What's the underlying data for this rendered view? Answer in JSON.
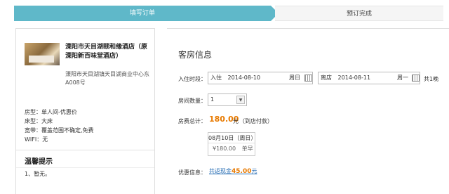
{
  "progress": {
    "step1": "填写订单",
    "step2": "预订完成"
  },
  "hotel": {
    "name": "溧阳市天目湖颐和缘酒店（原溧阳新百味堂酒店）",
    "address": "溧阳市天目湖镇天目湖商业中心东A008号",
    "room_type_label": "房型：",
    "room_type": "单人间-优惠价",
    "bed_label": "床型：",
    "bed": "大床",
    "broadband_label": "宽带：",
    "broadband": "覆盖范围不确定,免费",
    "wifi_label": "WIFI：",
    "wifi": "无"
  },
  "tips": {
    "title": "温馨提示",
    "item1": "1、暂无。"
  },
  "form": {
    "section_title": "客房信息",
    "stay_label": "入住时段：",
    "checkin_prefix": "入住",
    "checkin_date": "2014-08-10",
    "checkin_weekday": "周日",
    "checkout_prefix": "离店",
    "checkout_date": "2014-08-11",
    "checkout_weekday": "周一",
    "nights": "共1晚",
    "rooms_label": "房间数量：",
    "rooms_value": "1",
    "total_label": "房费总计：",
    "total_amount": "180.00",
    "total_unit": "元",
    "total_note": "（到店付款）",
    "day_date": "08月10日（周日）",
    "day_price": "¥180.00",
    "day_breakfast": "单早",
    "promo_label": "优惠信息：",
    "promo_text": "共返现金",
    "promo_amount": "45.00",
    "promo_unit": "元"
  }
}
